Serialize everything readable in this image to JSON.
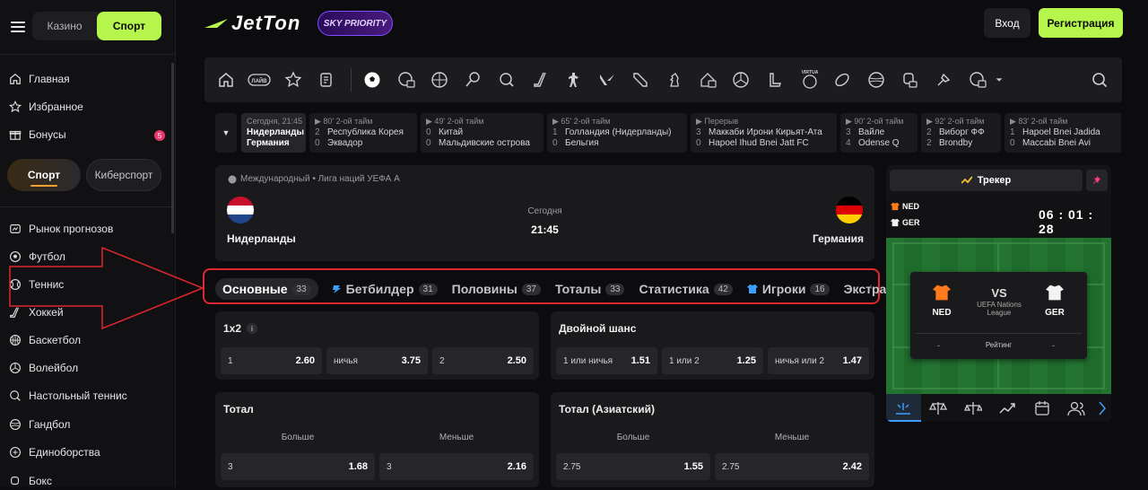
{
  "sidebar": {
    "casino_label": "Казино",
    "sport_label": "Спорт",
    "items": [
      {
        "label": "Главная",
        "icon": "home-icon"
      },
      {
        "label": "Избранное",
        "icon": "star-icon"
      },
      {
        "label": "Бонусы",
        "icon": "gift-icon",
        "badge": "5"
      }
    ],
    "sport_tab": "Спорт",
    "esport_tab": "Киберспорт",
    "sports": [
      {
        "label": "Рынок прогнозов",
        "icon": "prediction-icon"
      },
      {
        "label": "Футбол",
        "icon": "football-icon"
      },
      {
        "label": "Теннис",
        "icon": "tennis-icon"
      },
      {
        "label": "Хоккей",
        "icon": "hockey-icon"
      },
      {
        "label": "Баскетбол",
        "icon": "basketball-icon"
      },
      {
        "label": "Волейбол",
        "icon": "volleyball-icon"
      },
      {
        "label": "Настольный теннис",
        "icon": "table-tennis-icon"
      },
      {
        "label": "Гандбол",
        "icon": "handball-icon"
      },
      {
        "label": "Единоборства",
        "icon": "martial-arts-icon"
      },
      {
        "label": "Бокс",
        "icon": "boxing-icon"
      }
    ]
  },
  "header": {
    "logo": "JetTon",
    "partner_logo": "SKY PRIORITY",
    "login_label": "Вход",
    "register_label": "Регистрация"
  },
  "sportbar": {
    "live_label": "ЛАЙВ"
  },
  "ticker": [
    {
      "status": "Сегодня, 21:45",
      "team1": "Нидерланды",
      "team2": "Германия",
      "s1": "",
      "s2": ""
    },
    {
      "status": "80' 2-ой тайм",
      "team1": "Республика Корея",
      "team2": "Эквадор",
      "s1": "2",
      "s2": "0"
    },
    {
      "status": "49' 2-ой тайм",
      "team1": "Китай",
      "team2": "Мальдивские острова",
      "s1": "0",
      "s2": "0"
    },
    {
      "status": "65' 2-ой тайм",
      "team1": "Голландия (Нидерланды)",
      "team2": "Бельгия",
      "s1": "1",
      "s2": "0"
    },
    {
      "status": "Перерыв",
      "team1": "Маккаби Ирони Кирьят-Ата",
      "team2": "Hapoel Ihud Bnei Jatt FC",
      "s1": "3",
      "s2": "0"
    },
    {
      "status": "90' 2-ой тайм",
      "team1": "Вайле",
      "team2": "Odense Q",
      "s1": "3",
      "s2": "4"
    },
    {
      "status": "92' 2-ой тайм",
      "team1": "Виборг ФФ",
      "team2": "Brondby",
      "s1": "2",
      "s2": "2"
    },
    {
      "status": "83' 2-ой тайм",
      "team1": "Hapoel Bnei Jadida",
      "team2": "Maccabi Bnei Avi",
      "s1": "1",
      "s2": "0"
    }
  ],
  "match": {
    "league": "Международный • Лига наций УЕФА А",
    "home": "Нидерланды",
    "away": "Германия",
    "date": "Сегодня",
    "time": "21:45"
  },
  "market_tabs": [
    {
      "label": "Основные",
      "count": "33"
    },
    {
      "label": "Бетбилдер",
      "count": "31"
    },
    {
      "label": "Половины",
      "count": "37"
    },
    {
      "label": "Тоталы",
      "count": "33"
    },
    {
      "label": "Статистика",
      "count": "42"
    },
    {
      "label": "Игроки",
      "count": "16"
    },
    {
      "label": "Экстра",
      "count": "32"
    }
  ],
  "markets": {
    "x12": {
      "title": "1x2",
      "odds": [
        {
          "label": "1",
          "value": "2.60"
        },
        {
          "label": "ничья",
          "value": "3.75"
        },
        {
          "label": "2",
          "value": "2.50"
        }
      ]
    },
    "double": {
      "title": "Двойной шанс",
      "odds": [
        {
          "label": "1 или ничья",
          "value": "1.51"
        },
        {
          "label": "1 или 2",
          "value": "1.25"
        },
        {
          "label": "ничья или 2",
          "value": "1.47"
        }
      ]
    },
    "total": {
      "title": "Тотал",
      "over": "Больше",
      "under": "Меньше",
      "odds": [
        {
          "label": "3",
          "value": "1.68"
        },
        {
          "label": "3",
          "value": "2.16"
        }
      ]
    },
    "asian": {
      "title": "Тотал (Азиатский)",
      "over": "Больше",
      "under": "Меньше",
      "odds": [
        {
          "label": "2.75",
          "value": "1.55"
        },
        {
          "label": "2.75",
          "value": "2.42"
        }
      ]
    }
  },
  "tracker": {
    "title": "Трекер",
    "home_code": "NED",
    "away_code": "GER",
    "clock": "06 : 01 : 28",
    "vs": "VS",
    "league": "UEFA Nations League",
    "rating_label": "Рейтинг",
    "home_rating": "-",
    "away_rating": "-"
  },
  "colors": {
    "accent": "#b5f54c",
    "highlight": "#e0262f",
    "pitch": "#1f6b2b"
  }
}
